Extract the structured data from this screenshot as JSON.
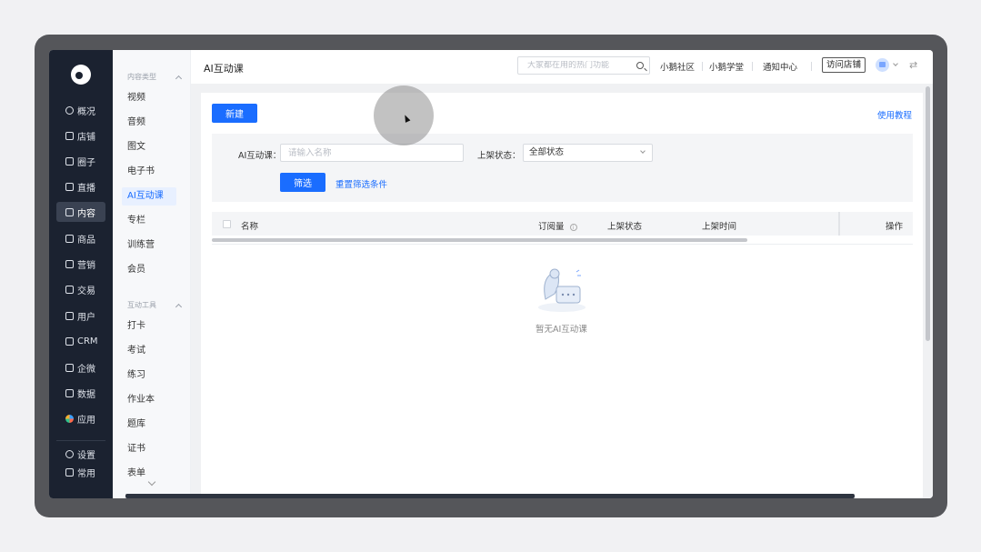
{
  "sidebar_primary": {
    "items": [
      {
        "label": "概况",
        "icon": "pie-chart-icon"
      },
      {
        "label": "店铺",
        "icon": "store-icon"
      },
      {
        "label": "圈子",
        "icon": "group-icon"
      },
      {
        "label": "直播",
        "icon": "live-icon"
      },
      {
        "label": "内容",
        "icon": "content-icon",
        "active": true
      },
      {
        "label": "商品",
        "icon": "goods-icon"
      },
      {
        "label": "营销",
        "icon": "marketing-icon"
      },
      {
        "label": "交易",
        "icon": "trade-icon"
      },
      {
        "label": "用户",
        "icon": "user-icon"
      },
      {
        "label": "CRM",
        "icon": "crm-icon"
      },
      {
        "label": "企微",
        "icon": "wecom-icon"
      },
      {
        "label": "数据",
        "icon": "data-icon"
      },
      {
        "label": "应用",
        "icon": "apps-icon"
      }
    ],
    "bottom": [
      {
        "label": "设置",
        "icon": "gear-icon"
      },
      {
        "label": "常用",
        "icon": "menu-icon"
      }
    ]
  },
  "sidebar_secondary": {
    "group1_title": "内容类型",
    "group1_items": [
      "视频",
      "音频",
      "图文",
      "电子书",
      "AI互动课",
      "专栏",
      "训练营",
      "会员"
    ],
    "group2_title": "互动工具",
    "group2_items": [
      "打卡",
      "考试",
      "练习",
      "作业本",
      "题库",
      "证书",
      "表单"
    ]
  },
  "header": {
    "title": "AI互动课",
    "search_placeholder": "大家都在用的热门功能",
    "links": [
      "小鹅社区",
      "小鹅学堂",
      "通知中心"
    ],
    "visit_store": "访问店铺"
  },
  "main": {
    "new_button": "新建",
    "tutorial_link": "使用教程",
    "filter": {
      "name_label": "AI互动课：",
      "name_placeholder": "请输入名称",
      "status_label": "上架状态：",
      "status_value": "全部状态",
      "filter_button": "筛选",
      "reset_link": "重置筛选条件"
    },
    "table": {
      "columns": [
        "名称",
        "订阅量",
        "上架状态",
        "上架时间",
        "操作"
      ]
    },
    "empty_text": "暂无AI互动课"
  },
  "colors": {
    "primary": "#1a6dff",
    "sidebar_dark": "#1b2230"
  }
}
